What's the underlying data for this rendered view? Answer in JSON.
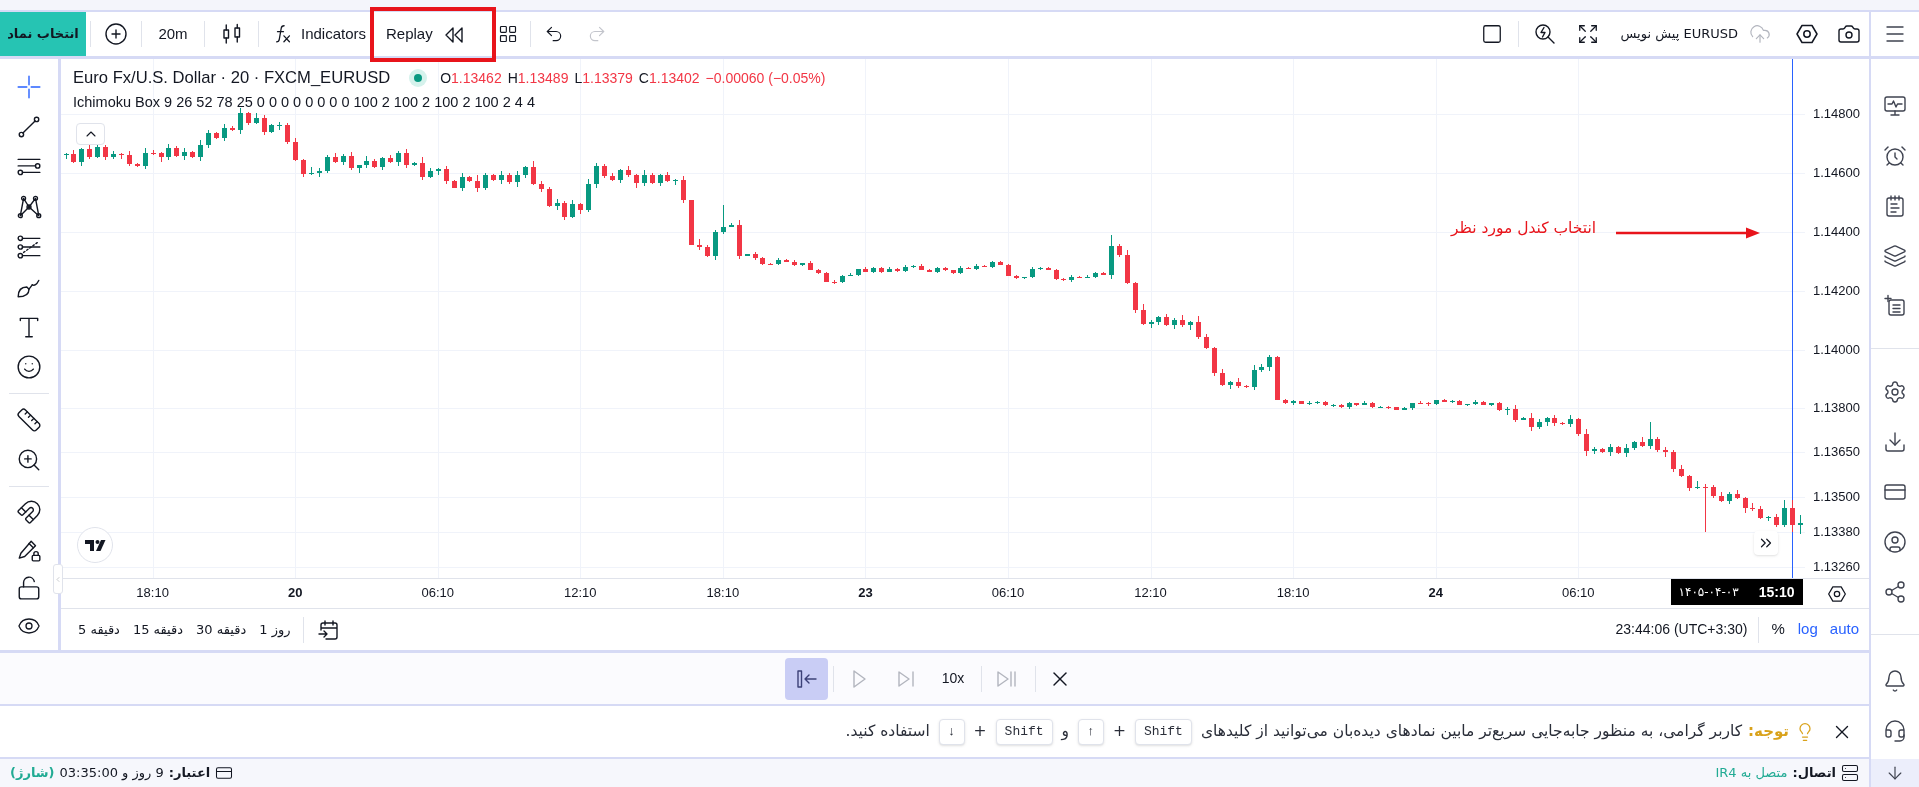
{
  "top_bar": {
    "symbol_button": "انتخاب نماد",
    "interval": "20m",
    "indicators": "Indicators",
    "replay": {
      "label": "Replay",
      "highlighted": true
    },
    "history": [
      {
        "kind": "undo",
        "disabled": false
      },
      {
        "kind": "redo",
        "disabled": true
      }
    ],
    "layout_name": "EURUSD پیش نویس"
  },
  "drawing_tools": [
    {
      "tools": [
        {
          "kind": "crosshair",
          "selected": true
        },
        {
          "kind": "trend-line",
          "selected": false
        },
        {
          "kind": "channel",
          "selected": false
        },
        {
          "kind": "pattern",
          "selected": false
        },
        {
          "kind": "fib",
          "selected": false
        },
        {
          "kind": "brush",
          "selected": false
        },
        {
          "kind": "text",
          "selected": false
        },
        {
          "kind": "emoji",
          "selected": false
        }
      ]
    },
    {
      "tools": [
        {
          "kind": "ruler",
          "selected": false
        },
        {
          "kind": "zoom",
          "selected": false
        }
      ]
    },
    {
      "tools": [
        {
          "kind": "magnet",
          "selected": false
        },
        {
          "kind": "lock-drawings",
          "selected": false
        },
        {
          "kind": "lock",
          "selected": false
        },
        {
          "kind": "eye",
          "selected": false
        }
      ]
    }
  ],
  "legend": {
    "title": "Euro Fx/U.S. Dollar · 20 · FXCM_EURUSD",
    "market_open": true,
    "ohlc": {
      "open": {
        "key": "O",
        "value": "1.13462"
      },
      "high": {
        "key": "H",
        "value": "1.13489"
      },
      "low": {
        "key": "L",
        "value": "1.13379"
      },
      "close": {
        "key": "C",
        "value": "1.13402"
      }
    },
    "change": "−0.00060 (−0.05%)",
    "indicator": "Ichimoku Box 9 26 52 78 25 0 0 0 0 0 0 0 0 100 2 100 2 100 2 100 2 4 4"
  },
  "annotation": {
    "text": "انتخاب کندل مورد نظر"
  },
  "chart": {
    "chart_data": {
      "type": "candlestick",
      "categories": [
        null,
        null,
        null,
        null,
        null,
        null,
        null,
        null,
        null,
        null,
        null,
        "18:10",
        null,
        null,
        null,
        null,
        null,
        null,
        null,
        null,
        null,
        null,
        null,
        null,
        null,
        null,
        null,
        null,
        null,
        "20",
        null,
        null,
        null,
        null,
        null,
        null,
        null,
        null,
        null,
        null,
        null,
        null,
        null,
        null,
        null,
        null,
        null,
        "06:10",
        null,
        null,
        null,
        null,
        null,
        null,
        null,
        null,
        null,
        null,
        null,
        null,
        null,
        null,
        null,
        null,
        null,
        "12:10",
        null,
        null,
        null,
        null,
        null,
        null,
        null,
        null,
        null,
        null,
        null,
        null,
        null,
        null,
        null,
        null,
        null,
        "18:10",
        null,
        null,
        null,
        null,
        null,
        null,
        null,
        null,
        null,
        null,
        null,
        null,
        null,
        null,
        null,
        null,
        null,
        "23",
        null,
        null,
        null,
        null,
        null,
        null,
        null,
        null,
        null,
        null,
        null,
        null,
        null,
        null,
        null,
        null,
        null,
        "06:10",
        null,
        null,
        null,
        null,
        null,
        null,
        null,
        null,
        null,
        null,
        null,
        null,
        null,
        null,
        null,
        null,
        null,
        "12:10",
        null,
        null,
        null,
        null,
        null,
        null,
        null,
        null,
        null,
        null,
        null,
        null,
        null,
        null,
        null,
        null,
        null,
        "18:10",
        null,
        null,
        null,
        null,
        null,
        null,
        null,
        null,
        null,
        null,
        null,
        null,
        null,
        null,
        null,
        null,
        null,
        "24",
        null,
        null,
        null,
        null,
        null,
        null,
        null,
        null,
        null,
        null,
        null,
        null,
        null,
        null,
        null,
        null,
        null,
        "06:10",
        null,
        null,
        null,
        null,
        null,
        null,
        null,
        null,
        null,
        null,
        null,
        null,
        null,
        null,
        null,
        null,
        null,
        null,
        null,
        null,
        null,
        null,
        null,
        null,
        null,
        null,
        null,
        null
      ],
      "ohlc": [
        [
          1.1466,
          1.1467,
          1.14649,
          1.14664
        ],
        [
          1.14664,
          1.14678,
          1.14634,
          1.14639
        ],
        [
          1.14639,
          1.14684,
          1.14624,
          1.14681
        ],
        [
          1.14681,
          1.14699,
          1.14648,
          1.14656
        ],
        [
          1.14656,
          1.14699,
          1.14653,
          1.1469
        ],
        [
          1.1469,
          1.14695,
          1.14643,
          1.14654
        ],
        [
          1.14654,
          1.14676,
          1.14649,
          1.14664
        ],
        [
          1.14664,
          1.1467,
          1.14647,
          1.14662
        ],
        [
          1.14662,
          1.14676,
          1.14624,
          1.14632
        ],
        [
          1.14632,
          1.14635,
          1.14621,
          1.14624
        ],
        [
          1.14624,
          1.14687,
          1.14613,
          1.14669
        ],
        [
          1.14669,
          1.14678,
          1.14663,
          1.14668
        ],
        [
          1.14668,
          1.14673,
          1.14639,
          1.14654
        ],
        [
          1.14654,
          1.14698,
          1.14646,
          1.14686
        ],
        [
          1.14686,
          1.14692,
          1.14654,
          1.14657
        ],
        [
          1.14657,
          1.14685,
          1.14646,
          1.14671
        ],
        [
          1.14671,
          1.14674,
          1.14651,
          1.14656
        ],
        [
          1.14656,
          1.14712,
          1.14641,
          1.14694
        ],
        [
          1.14694,
          1.14745,
          1.14686,
          1.14736
        ],
        [
          1.14736,
          1.14741,
          1.14717,
          1.1472
        ],
        [
          1.1472,
          1.14766,
          1.14709,
          1.14754
        ],
        [
          1.14754,
          1.1476,
          1.14743,
          1.14748
        ],
        [
          1.14748,
          1.1482,
          1.14733,
          1.14806
        ],
        [
          1.14806,
          1.14809,
          1.14763,
          1.14771
        ],
        [
          1.14771,
          1.14806,
          1.14768,
          1.14788
        ],
        [
          1.14788,
          1.14797,
          1.1473,
          1.14741
        ],
        [
          1.14741,
          1.14768,
          1.14736,
          1.14763
        ],
        [
          1.14763,
          1.14775,
          1.14748,
          1.14763
        ],
        [
          1.14763,
          1.14769,
          1.14699,
          1.14707
        ],
        [
          1.14707,
          1.14721,
          1.14642,
          1.14645
        ],
        [
          1.14645,
          1.14648,
          1.14587,
          1.14598
        ],
        [
          1.14598,
          1.1462,
          1.14593,
          1.14602
        ],
        [
          1.14602,
          1.14617,
          1.14587,
          1.14608
        ],
        [
          1.14608,
          1.1466,
          1.146,
          1.14655
        ],
        [
          1.14655,
          1.14667,
          1.14635,
          1.14638
        ],
        [
          1.14638,
          1.14665,
          1.14627,
          1.14659
        ],
        [
          1.14659,
          1.14673,
          1.14612,
          1.14617
        ],
        [
          1.14617,
          1.14629,
          1.14602,
          1.14626
        ],
        [
          1.14626,
          1.14658,
          1.14618,
          1.1464
        ],
        [
          1.1464,
          1.14649,
          1.14618,
          1.14621
        ],
        [
          1.14621,
          1.14656,
          1.1461,
          1.14651
        ],
        [
          1.14651,
          1.14663,
          1.14633,
          1.14638
        ],
        [
          1.14638,
          1.14674,
          1.14623,
          1.14668
        ],
        [
          1.14668,
          1.14682,
          1.14619,
          1.14627
        ],
        [
          1.14627,
          1.14639,
          1.14624,
          1.14636
        ],
        [
          1.14636,
          1.14654,
          1.14577,
          1.14588
        ],
        [
          1.14588,
          1.14616,
          1.14583,
          1.14607
        ],
        [
          1.14607,
          1.14618,
          1.14592,
          1.14613
        ],
        [
          1.14613,
          1.14625,
          1.14564,
          1.14572
        ],
        [
          1.14572,
          1.14578,
          1.14548,
          1.14551
        ],
        [
          1.14551,
          1.14601,
          1.1454,
          1.14587
        ],
        [
          1.14587,
          1.1459,
          1.14569,
          1.14574
        ],
        [
          1.14574,
          1.14592,
          1.14536,
          1.14551
        ],
        [
          1.14551,
          1.14602,
          1.14543,
          1.14593
        ],
        [
          1.14593,
          1.14598,
          1.14572,
          1.14575
        ],
        [
          1.14575,
          1.14607,
          1.14564,
          1.14595
        ],
        [
          1.14595,
          1.14601,
          1.14564,
          1.14569
        ],
        [
          1.14569,
          1.14607,
          1.14554,
          1.14593
        ],
        [
          1.14593,
          1.14625,
          1.14585,
          1.14622
        ],
        [
          1.14622,
          1.1464,
          1.14561,
          1.14564
        ],
        [
          1.14564,
          1.14573,
          1.14536,
          1.14547
        ],
        [
          1.14547,
          1.14552,
          1.14484,
          1.14489
        ],
        [
          1.14489,
          1.14511,
          1.14474,
          1.14499
        ],
        [
          1.14499,
          1.14505,
          1.14442,
          1.1445
        ],
        [
          1.1445,
          1.14508,
          1.14447,
          1.14494
        ],
        [
          1.14494,
          1.14497,
          1.14462,
          1.14473
        ],
        [
          1.14473,
          1.14581,
          1.14468,
          1.14563
        ],
        [
          1.14563,
          1.14634,
          1.14548,
          1.14625
        ],
        [
          1.14625,
          1.1463,
          1.14582,
          1.1459
        ],
        [
          1.1459,
          1.14602,
          1.14573,
          1.14576
        ],
        [
          1.14576,
          1.14615,
          1.14565,
          1.14609
        ],
        [
          1.14609,
          1.14623,
          1.14588,
          1.14593
        ],
        [
          1.14593,
          1.14596,
          1.1455,
          1.14565
        ],
        [
          1.14565,
          1.1461,
          1.14557,
          1.14592
        ],
        [
          1.14592,
          1.14601,
          1.14564,
          1.14567
        ],
        [
          1.14567,
          1.14598,
          1.14556,
          1.14593
        ],
        [
          1.14593,
          1.14605,
          1.14569,
          1.14574
        ],
        [
          1.14574,
          1.14581,
          1.14559,
          1.14575
        ],
        [
          1.14575,
          1.14589,
          1.14499,
          1.14507
        ],
        [
          1.14507,
          1.1451,
          1.14354,
          1.14357
        ],
        [
          1.14357,
          1.14375,
          1.14337,
          1.14348
        ],
        [
          1.14348,
          1.14357,
          1.14314,
          1.14319
        ],
        [
          1.14319,
          1.14405,
          1.14304,
          1.144
        ],
        [
          1.144,
          1.1449,
          1.14392,
          1.14418
        ],
        [
          1.14418,
          1.14431,
          1.14415,
          1.14425
        ],
        [
          1.14425,
          1.14439,
          1.14308,
          1.14319
        ],
        [
          1.14319,
          1.14325,
          1.14317,
          1.14324
        ],
        [
          1.14324,
          1.1433,
          1.14305,
          1.1431
        ],
        [
          1.1431,
          1.14313,
          1.14288,
          1.14291
        ],
        [
          1.14291,
          1.14293,
          1.14289,
          1.1429
        ],
        [
          1.1429,
          1.1431,
          1.14286,
          1.14306
        ],
        [
          1.14306,
          1.14308,
          1.14297,
          1.14299
        ],
        [
          1.14299,
          1.14304,
          1.14283,
          1.14288
        ],
        [
          1.14288,
          1.14295,
          1.14285,
          1.14294
        ],
        [
          1.14294,
          1.143,
          1.14269,
          1.1427
        ],
        [
          1.1427,
          1.14273,
          1.14257,
          1.14261
        ],
        [
          1.14261,
          1.14263,
          1.14229,
          1.14231
        ],
        [
          1.14231,
          1.14235,
          1.14223,
          1.14228
        ],
        [
          1.14228,
          1.14252,
          1.14225,
          1.1425
        ],
        [
          1.1425,
          1.14259,
          1.14249,
          1.14254
        ],
        [
          1.14254,
          1.14275,
          1.1425,
          1.14274
        ],
        [
          1.14274,
          1.1428,
          1.14262,
          1.14264
        ],
        [
          1.14264,
          1.1428,
          1.14259,
          1.14277
        ],
        [
          1.14277,
          1.14279,
          1.1426,
          1.14263
        ],
        [
          1.14263,
          1.14279,
          1.14262,
          1.14275
        ],
        [
          1.14275,
          1.14277,
          1.14262,
          1.14266
        ],
        [
          1.14266,
          1.14287,
          1.14264,
          1.14282
        ],
        [
          1.14282,
          1.14286,
          1.14277,
          1.14285
        ],
        [
          1.14285,
          1.14291,
          1.14269,
          1.14272
        ],
        [
          1.14272,
          1.14275,
          1.14264,
          1.14265
        ],
        [
          1.14265,
          1.14279,
          1.14261,
          1.14277
        ],
        [
          1.14277,
          1.14281,
          1.14268,
          1.1427
        ],
        [
          1.1427,
          1.14272,
          1.14256,
          1.14261
        ],
        [
          1.14261,
          1.14283,
          1.14258,
          1.14278
        ],
        [
          1.14278,
          1.14279,
          1.14274,
          1.14275
        ],
        [
          1.14275,
          1.1429,
          1.14271,
          1.14284
        ],
        [
          1.14284,
          1.14287,
          1.1428,
          1.14282
        ],
        [
          1.14282,
          1.143,
          1.14277,
          1.14298
        ],
        [
          1.14298,
          1.14302,
          1.14286,
          1.14289
        ],
        [
          1.14289,
          1.14291,
          1.14249,
          1.1425
        ],
        [
          1.1425,
          1.14255,
          1.14239,
          1.14243
        ],
        [
          1.14243,
          1.14248,
          1.14241,
          1.14247
        ],
        [
          1.14247,
          1.14281,
          1.14242,
          1.14275
        ],
        [
          1.14275,
          1.1428,
          1.14272,
          1.14277
        ],
        [
          1.14277,
          1.14279,
          1.1427,
          1.14271
        ],
        [
          1.14271,
          1.14275,
          1.14237,
          1.14241
        ],
        [
          1.14241,
          1.14243,
          1.14233,
          1.14235
        ],
        [
          1.14235,
          1.14253,
          1.1423,
          1.14248
        ],
        [
          1.14248,
          1.14249,
          1.14242,
          1.14245
        ],
        [
          1.14245,
          1.14254,
          1.14244,
          1.14248
        ],
        [
          1.14248,
          1.14264,
          1.14244,
          1.14261
        ],
        [
          1.14261,
          1.14263,
          1.14253,
          1.14255
        ],
        [
          1.14255,
          1.1439,
          1.1424,
          1.14352
        ],
        [
          1.14352,
          1.14358,
          1.14315,
          1.14323
        ],
        [
          1.14323,
          1.14337,
          1.14224,
          1.14227
        ],
        [
          1.14227,
          1.1423,
          1.14125,
          1.14136
        ],
        [
          1.14136,
          1.14154,
          1.14082,
          1.14087
        ],
        [
          1.14087,
          1.14102,
          1.14072,
          1.14093
        ],
        [
          1.14093,
          1.14114,
          1.14085,
          1.14109
        ],
        [
          1.14109,
          1.14121,
          1.14079,
          1.14082
        ],
        [
          1.14082,
          1.14108,
          1.14071,
          1.14102
        ],
        [
          1.14102,
          1.14116,
          1.14078,
          1.14083
        ],
        [
          1.14083,
          1.14098,
          1.14068,
          1.14095
        ],
        [
          1.14095,
          1.14113,
          1.14035,
          1.14043
        ],
        [
          1.14043,
          1.14052,
          1.14001,
          1.14004
        ],
        [
          1.14004,
          1.14009,
          1.1391,
          1.13921
        ],
        [
          1.13921,
          1.13933,
          1.13876,
          1.13881
        ],
        [
          1.13881,
          1.13894,
          1.13866,
          1.13888
        ],
        [
          1.13888,
          1.13902,
          1.13868,
          1.13876
        ],
        [
          1.13876,
          1.13879,
          1.1387,
          1.13873
        ],
        [
          1.13873,
          1.13948,
          1.13862,
          1.1393
        ],
        [
          1.1393,
          1.13951,
          1.13925,
          1.13942
        ],
        [
          1.13942,
          1.1398,
          1.13927,
          1.13975
        ],
        [
          1.13975,
          1.13979,
          1.13827,
          1.1383
        ],
        [
          1.1383,
          1.13832,
          1.13816,
          1.13817
        ],
        [
          1.13817,
          1.1383,
          1.13813,
          1.13825
        ],
        [
          1.13825,
          1.13826,
          1.13814,
          1.13816
        ],
        [
          1.13816,
          1.13825,
          1.13811,
          1.13819
        ],
        [
          1.13819,
          1.13826,
          1.13816,
          1.13823
        ],
        [
          1.13823,
          1.13825,
          1.13809,
          1.1381
        ],
        [
          1.1381,
          1.13816,
          1.13806,
          1.13812
        ],
        [
          1.13812,
          1.13814,
          1.13801,
          1.13803
        ],
        [
          1.13803,
          1.13822,
          1.13798,
          1.13817
        ],
        [
          1.13817,
          1.13818,
          1.13808,
          1.13811
        ],
        [
          1.13811,
          1.13825,
          1.1381,
          1.13819
        ],
        [
          1.13819,
          1.13822,
          1.138,
          1.13804
        ],
        [
          1.13804,
          1.13807,
          1.13802,
          1.13805
        ],
        [
          1.13805,
          1.13809,
          1.13798,
          1.13803
        ],
        [
          1.13803,
          1.13805,
          1.13793,
          1.13796
        ],
        [
          1.13796,
          1.13805,
          1.13795,
          1.138
        ],
        [
          1.138,
          1.13819,
          1.13796,
          1.13818
        ],
        [
          1.13818,
          1.13824,
          1.13815,
          1.13817
        ],
        [
          1.13817,
          1.1382,
          1.13809,
          1.13814
        ],
        [
          1.13814,
          1.13829,
          1.13811,
          1.13827
        ],
        [
          1.13827,
          1.13831,
          1.13822,
          1.13823
        ],
        [
          1.13823,
          1.13827,
          1.13819,
          1.13825
        ],
        [
          1.13825,
          1.1383,
          1.13811,
          1.13813
        ],
        [
          1.13813,
          1.13816,
          1.13808,
          1.13815
        ],
        [
          1.13815,
          1.13828,
          1.13812,
          1.13822
        ],
        [
          1.13822,
          1.13825,
          1.13812,
          1.13813
        ],
        [
          1.13813,
          1.13819,
          1.13809,
          1.13817
        ],
        [
          1.13817,
          1.13821,
          1.13791,
          1.13793
        ],
        [
          1.13793,
          1.13804,
          1.13778,
          1.13798
        ],
        [
          1.13798,
          1.13812,
          1.13754,
          1.13762
        ],
        [
          1.13762,
          1.1377,
          1.13759,
          1.13767
        ],
        [
          1.13767,
          1.13785,
          1.13724,
          1.13735
        ],
        [
          1.13735,
          1.13764,
          1.1373,
          1.13755
        ],
        [
          1.13755,
          1.13772,
          1.1374,
          1.13767
        ],
        [
          1.13767,
          1.13779,
          1.13741,
          1.13749
        ],
        [
          1.13749,
          1.13755,
          1.13743,
          1.13746
        ],
        [
          1.13746,
          1.13777,
          1.13735,
          1.13763
        ],
        [
          1.13763,
          1.13766,
          1.13707,
          1.13712
        ],
        [
          1.13712,
          1.1373,
          1.13639,
          1.13654
        ],
        [
          1.13654,
          1.1367,
          1.13646,
          1.13661
        ],
        [
          1.13661,
          1.13666,
          1.13647,
          1.1365
        ],
        [
          1.1365,
          1.13679,
          1.13639,
          1.13667
        ],
        [
          1.13667,
          1.13673,
          1.13643,
          1.13648
        ],
        [
          1.13648,
          1.13679,
          1.13633,
          1.13665
        ],
        [
          1.13665,
          1.13688,
          1.13657,
          1.13685
        ],
        [
          1.13685,
          1.13703,
          1.13668,
          1.13671
        ],
        [
          1.13671,
          1.13753,
          1.1366,
          1.13696
        ],
        [
          1.13696,
          1.13701,
          1.13653,
          1.13658
        ],
        [
          1.13658,
          1.1367,
          1.13636,
          1.13651
        ],
        [
          1.13651,
          1.13657,
          1.13585,
          1.13593
        ],
        [
          1.13593,
          1.13607,
          1.13567,
          1.1357
        ],
        [
          1.1357,
          1.13573,
          1.13519,
          1.1353
        ],
        [
          1.1353,
          1.13552,
          1.13525,
          1.13534
        ],
        [
          1.13534,
          1.13543,
          1.1338,
          1.13533
        ],
        [
          1.13533,
          1.13538,
          1.13495,
          1.13503
        ],
        [
          1.13503,
          1.13515,
          1.13483,
          1.13486
        ],
        [
          1.13486,
          1.13515,
          1.13475,
          1.13509
        ],
        [
          1.13509,
          1.13523,
          1.1349,
          1.13495
        ],
        [
          1.13495,
          1.13498,
          1.13445,
          1.1346
        ],
        [
          1.1346,
          1.13478,
          1.1345,
          1.13458
        ],
        [
          1.13458,
          1.13467,
          1.13425,
          1.13428
        ],
        [
          1.13428,
          1.13434,
          1.13418,
          1.13429
        ],
        [
          1.13429,
          1.13441,
          1.13398,
          1.13403
        ],
        [
          1.13403,
          1.13488,
          1.13395,
          1.13462
        ],
        [
          1.13462,
          1.13489,
          1.13379,
          1.13402
        ],
        [
          1.13402,
          1.13438,
          1.13372,
          1.1341
        ]
      ],
      "ylim": [
        1.13223,
        1.14988
      ],
      "yticks": [
        {
          "value": 1.148,
          "label": "1.14800"
        },
        {
          "value": 1.146,
          "label": "1.14600"
        },
        {
          "value": 1.144,
          "label": "1.14400"
        },
        {
          "value": 1.142,
          "label": "1.14200"
        },
        {
          "value": 1.14,
          "label": "1.14000"
        },
        {
          "value": 1.138,
          "label": "1.13800"
        },
        {
          "value": 1.1365,
          "label": "1.13650"
        },
        {
          "value": 1.135,
          "label": "1.13500"
        },
        {
          "value": 1.1338,
          "label": "1.13380"
        },
        {
          "value": 1.1326,
          "label": "1.13260"
        }
      ],
      "grid": true
    },
    "tick_bold": [
      false,
      true,
      false,
      false,
      false,
      true,
      false,
      false,
      false,
      true,
      false
    ],
    "cursor": {
      "date": "۱۴۰۵-۰۴-۰۳",
      "time": "15:10"
    }
  },
  "chart_footer": {
    "timeframes": [
      "1 روز",
      "30 دقیقه",
      "15 دقیقه",
      "5 دقیقه"
    ],
    "clock": "23:44:06 (UTC+3:30)",
    "percent": "%",
    "log": "log",
    "auto": "auto"
  },
  "replay_bar": {
    "controls": [
      {
        "kind": "jump-back",
        "selected": true,
        "disabled": false
      },
      {
        "kind": "play",
        "selected": false,
        "disabled": true
      },
      {
        "kind": "step",
        "selected": false,
        "disabled": true
      },
      {
        "kind": "speed",
        "label": "10x",
        "selected": false,
        "disabled": false
      },
      {
        "kind": "step-all",
        "selected": false,
        "disabled": true
      },
      {
        "kind": "close",
        "selected": false,
        "disabled": false
      }
    ]
  },
  "notice": {
    "label": "توجه:",
    "parts": [
      {
        "kind": "text",
        "text": "کاربر گرامی، به منظور جابه‌جایی سریع‌تر مابین نمادهای دیده‌بان می‌توانید از کلیدهای"
      },
      {
        "kind": "key",
        "text": "Shift"
      },
      {
        "kind": "text",
        "text": "+"
      },
      {
        "kind": "key",
        "text": "↑"
      },
      {
        "kind": "text",
        "text": "و"
      },
      {
        "kind": "key",
        "text": "Shift"
      },
      {
        "kind": "text",
        "text": "+"
      },
      {
        "kind": "key",
        "text": "↓"
      },
      {
        "kind": "text",
        "text": "استفاده کنید."
      }
    ]
  },
  "status_bar": {
    "credit": {
      "label": "اعتبار:",
      "value": "9 روز و 03:35:00",
      "action": "(شارژ)"
    },
    "connection": {
      "label": "اتصال:",
      "value": "متصل به IR4"
    }
  }
}
